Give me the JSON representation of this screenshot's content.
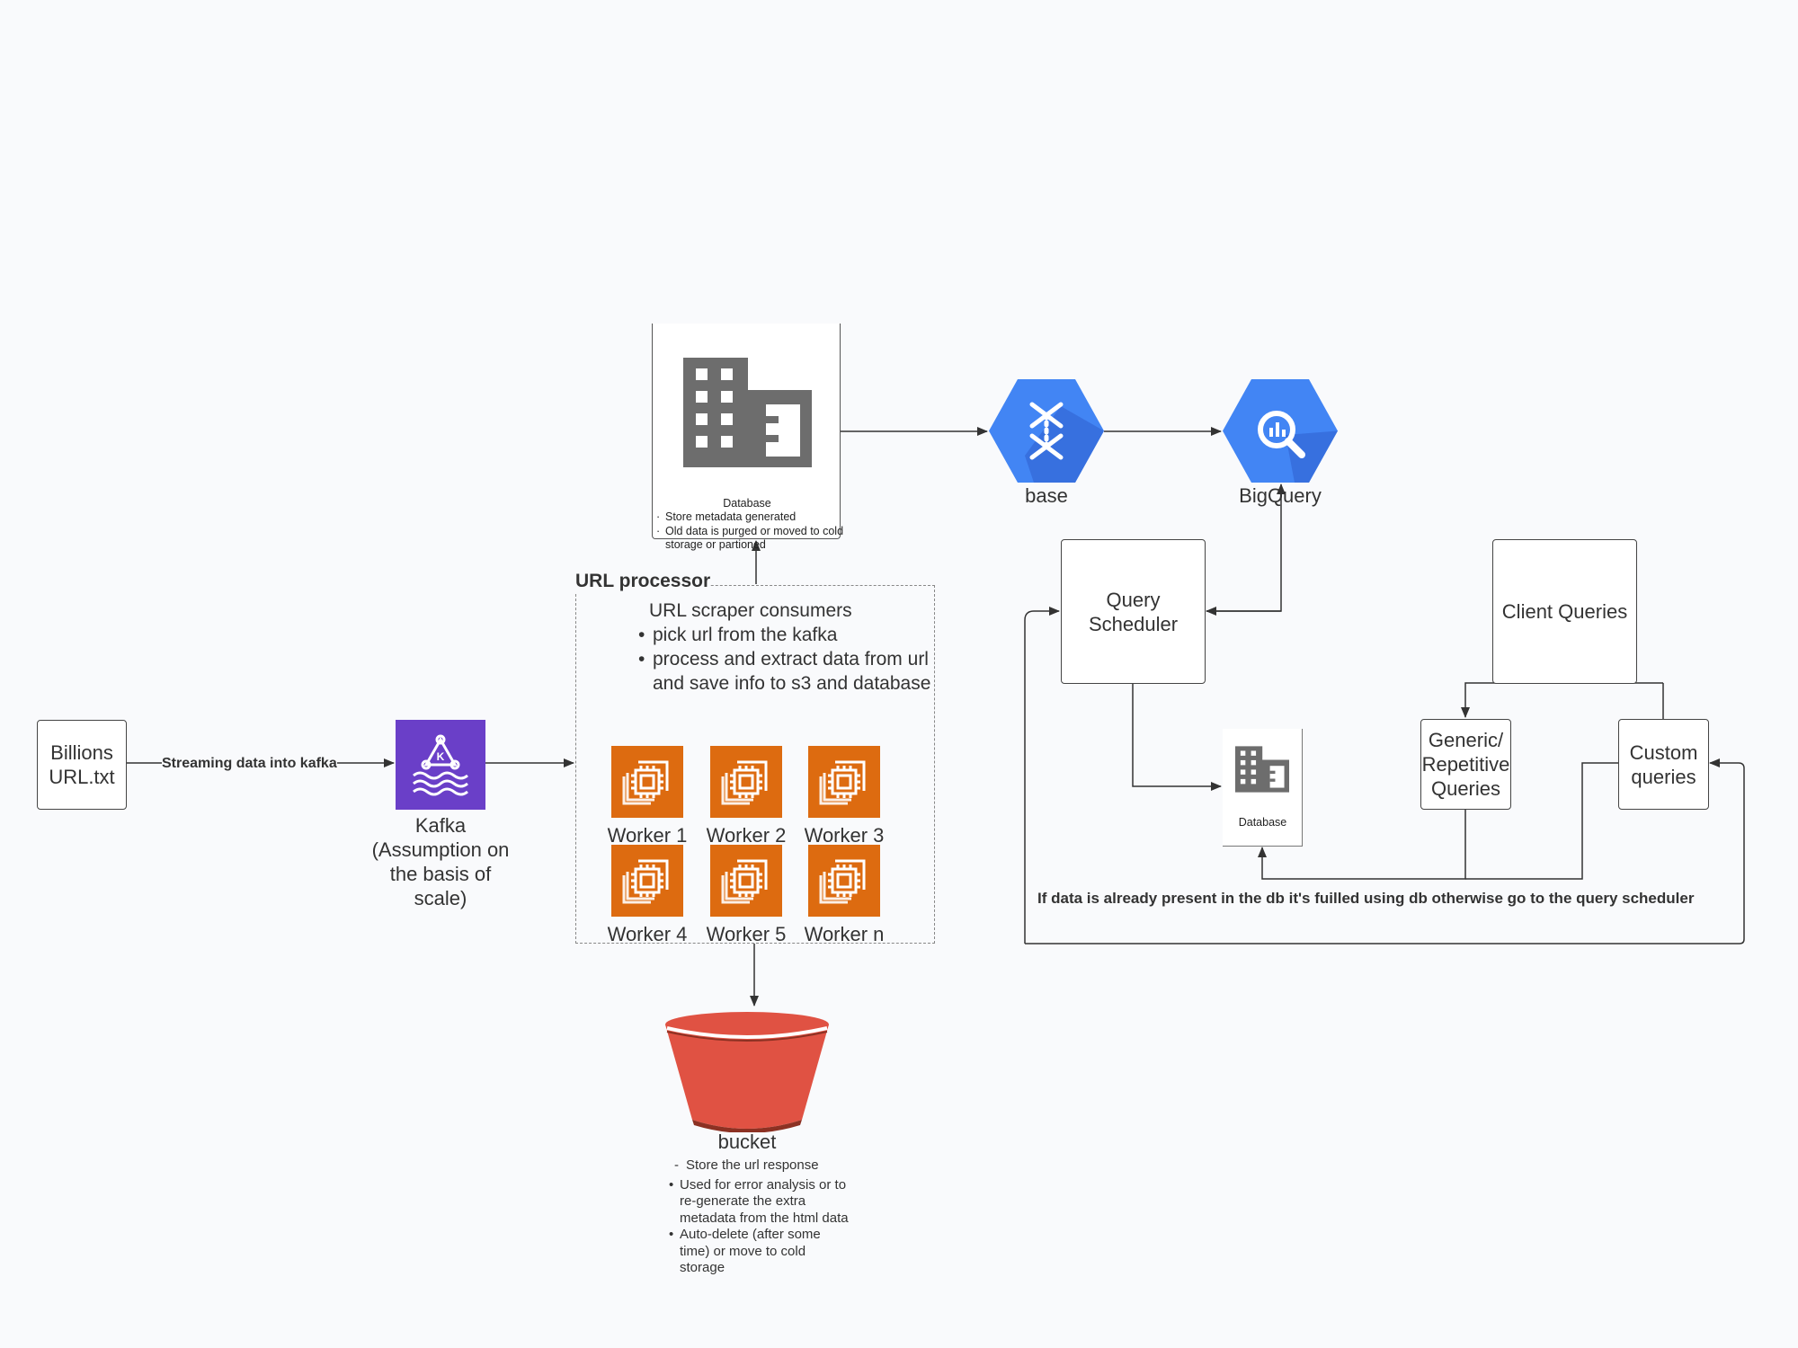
{
  "nodes": {
    "billions": "Billions URL.txt",
    "streaming_label": "Streaming  data into kafka",
    "kafka": {
      "lines": [
        "Kafka",
        "(Assumption on",
        "the basis of",
        "scale)"
      ],
      "icon": "kafka-icon",
      "color": "#6a3fc8"
    },
    "database_top": {
      "title": "Database",
      "bullets": [
        "Store metadata generated",
        "Old data is purged or moved to cold storage or partioned"
      ],
      "icon": "building-icon"
    },
    "url_processor": {
      "title": "URL processor",
      "heading": "URL scraper consumers",
      "bullets": [
        "pick url from the kafka",
        "process and extract data from url and save info to s3 and database"
      ],
      "workers": [
        "Worker 1",
        "Worker 2",
        "Worker 3",
        "Worker 4",
        "Worker 5",
        "Worker n"
      ],
      "worker_color": "#dd6b10"
    },
    "bucket": {
      "label": "bucket",
      "dash_item": "Store the url response",
      "bullets": [
        "Used for error analysis or to re-generate the extra metadata from the html data",
        "Auto-delete (after some time) or move to cold storage"
      ],
      "color": "#e05243"
    },
    "base": {
      "label": "base",
      "icon": "dataflow-icon",
      "color": "#4285f4"
    },
    "bigquery": {
      "label": "BigQuery",
      "icon": "bigquery-icon",
      "color": "#4285f4"
    },
    "query_scheduler": "Query Scheduler",
    "database_small": "Database",
    "client_queries": "Client Queries",
    "generic_queries": "Generic/ Repetitive Queries",
    "custom_queries": "Custom queries",
    "note": "If data is already present in the db it's fuilled using db otherwise go to the query scheduler"
  }
}
